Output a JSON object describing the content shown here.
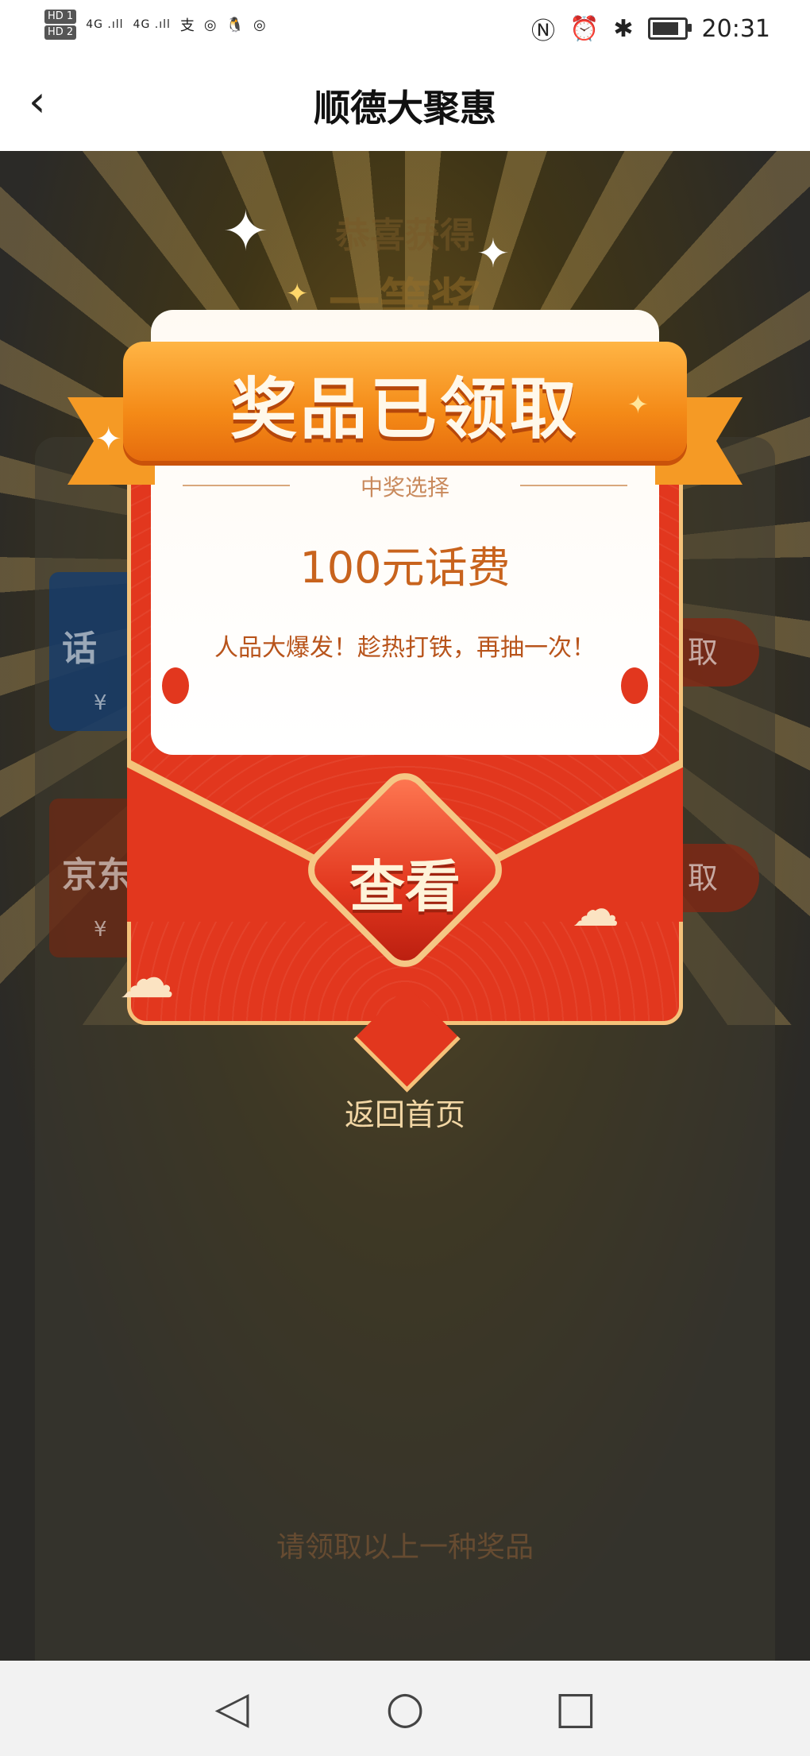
{
  "status_bar": {
    "hd1": "HD 1",
    "hd2": "HD 2",
    "signal1": "4G .ıll",
    "signal2": "4G .ıll",
    "app_icons": [
      "支",
      "◎",
      "🐧",
      "◎"
    ],
    "time": "20:31",
    "battery_level": 0.85
  },
  "header": {
    "back_icon": "chevron-left-icon",
    "title": "顺德大聚惠"
  },
  "background": {
    "heading": "恭喜获得",
    "heading2": "一等奖",
    "card1_title": "话",
    "card1_currency": "¥",
    "card2_title": "京东",
    "card2_currency": "¥",
    "button1": "取",
    "button2": "取",
    "footer": "请领取以上一种奖品"
  },
  "modal": {
    "ribbon_title": "奖品已领取",
    "section_label": "中奖选择",
    "prize": "100元话费",
    "tagline": "人品大爆发！趁热打铁，再抽一次！",
    "view_button": "查看",
    "return_link": "返回首页"
  },
  "nav_bar": {
    "back": "◁",
    "home": "○",
    "recent": "□"
  }
}
